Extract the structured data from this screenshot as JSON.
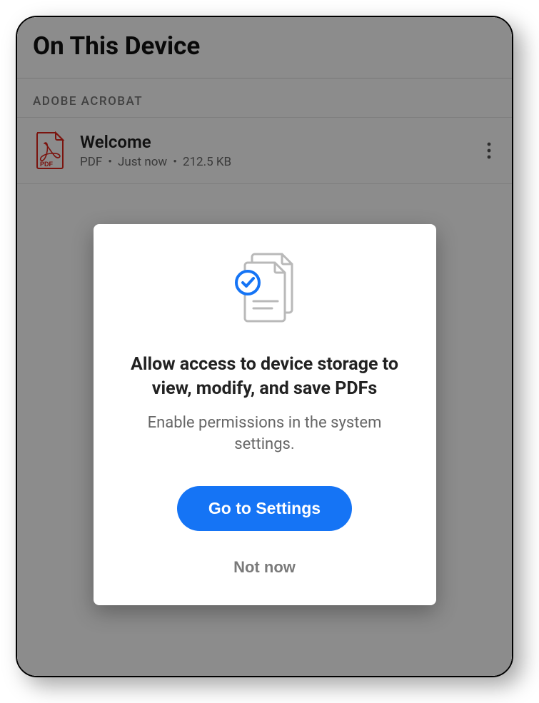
{
  "header": {
    "title": "On This Device"
  },
  "section": {
    "label": "ADOBE ACROBAT"
  },
  "file": {
    "title": "Welcome",
    "type": "PDF",
    "modified": "Just now",
    "size": "212.5 KB",
    "icon_badge": "PDF"
  },
  "dialog": {
    "title": "Allow access to device storage to view, modify, and save PDFs",
    "body": "Enable permissions in the system settings.",
    "primary": "Go to Settings",
    "secondary": "Not now"
  }
}
